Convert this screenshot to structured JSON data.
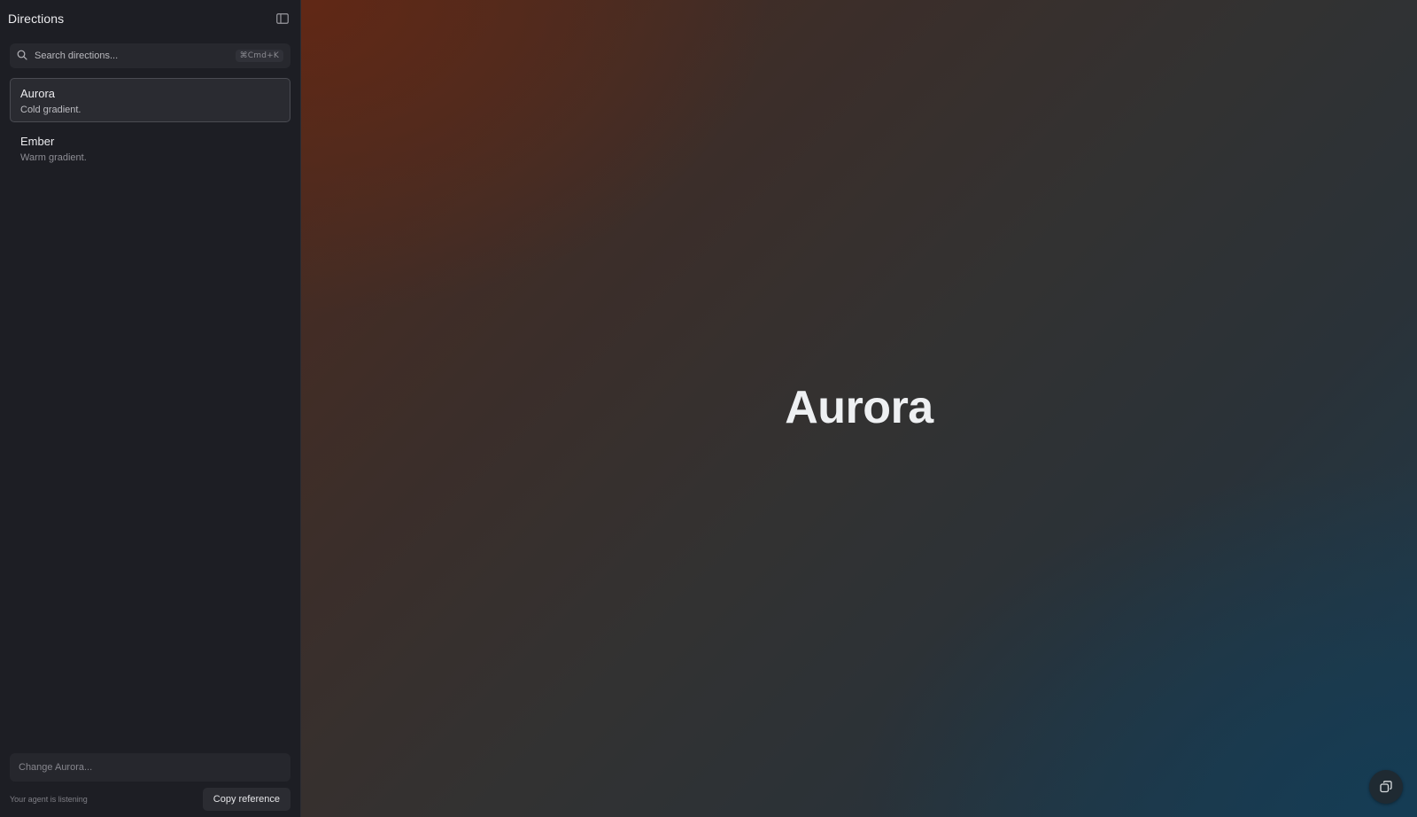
{
  "sidebar": {
    "title": "Directions",
    "toggle_icon": "sidebar-panel-icon",
    "search": {
      "placeholder": "Search directions...",
      "shortcut": "⌘Cmd+K",
      "icon": "search-icon"
    },
    "items": [
      {
        "name": "Aurora",
        "description": "Cold gradient.",
        "active": true
      },
      {
        "name": "Ember",
        "description": "Warm gradient.",
        "active": false
      }
    ],
    "change_input": {
      "placeholder": "Change Aurora..."
    },
    "status": "Your agent is listening",
    "copy_label": "Copy reference"
  },
  "main": {
    "title": "Aurora",
    "corner_icon": "copy-windows-icon"
  },
  "colors": {
    "sidebar_bg": "#1d1e24",
    "gradient_warm": "#4d2a1e",
    "gradient_cold": "#1e3a4c"
  }
}
